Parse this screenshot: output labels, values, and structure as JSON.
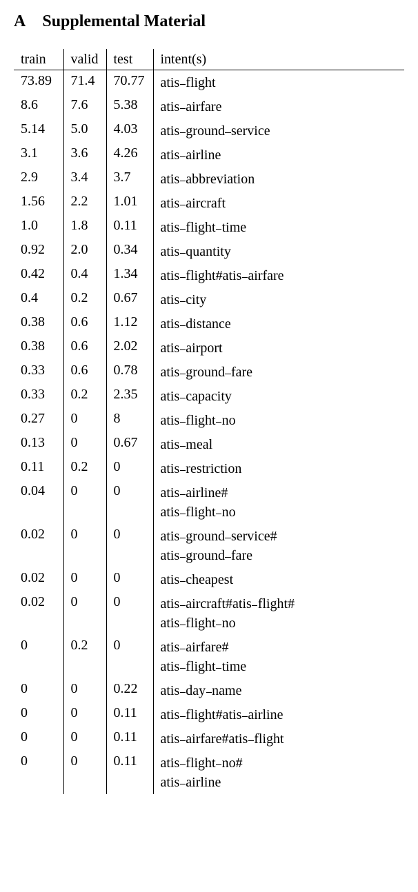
{
  "heading": {
    "section": "A",
    "title": "Supplemental Material"
  },
  "table": {
    "headers": {
      "train": "train",
      "valid": "valid",
      "test": "test",
      "intent": "intent(s)"
    },
    "rows": [
      {
        "train": "73.89",
        "valid": "71.4",
        "test": "70.77",
        "intent": [
          "atis_flight"
        ]
      },
      {
        "train": "8.6",
        "valid": "7.6",
        "test": "5.38",
        "intent": [
          "atis_airfare"
        ]
      },
      {
        "train": "5.14",
        "valid": "5.0",
        "test": "4.03",
        "intent": [
          "atis_ground_service"
        ]
      },
      {
        "train": "3.1",
        "valid": "3.6",
        "test": "4.26",
        "intent": [
          "atis_airline"
        ]
      },
      {
        "train": "2.9",
        "valid": "3.4",
        "test": "3.7",
        "intent": [
          "atis_abbreviation"
        ]
      },
      {
        "train": "1.56",
        "valid": "2.2",
        "test": "1.01",
        "intent": [
          "atis_aircraft"
        ]
      },
      {
        "train": "1.0",
        "valid": "1.8",
        "test": "0.11",
        "intent": [
          "atis_flight_time"
        ]
      },
      {
        "train": "0.92",
        "valid": "2.0",
        "test": "0.34",
        "intent": [
          "atis_quantity"
        ]
      },
      {
        "train": "0.42",
        "valid": "0.4",
        "test": "1.34",
        "intent": [
          "atis_flight#atis_airfare"
        ]
      },
      {
        "train": "0.4",
        "valid": "0.2",
        "test": "0.67",
        "intent": [
          "atis_city"
        ]
      },
      {
        "train": "0.38",
        "valid": "0.6",
        "test": "1.12",
        "intent": [
          "atis_distance"
        ]
      },
      {
        "train": "0.38",
        "valid": "0.6",
        "test": "2.02",
        "intent": [
          "atis_airport"
        ]
      },
      {
        "train": "0.33",
        "valid": "0.6",
        "test": "0.78",
        "intent": [
          "atis_ground_fare"
        ]
      },
      {
        "train": "0.33",
        "valid": "0.2",
        "test": "2.35",
        "intent": [
          "atis_capacity"
        ]
      },
      {
        "train": "0.27",
        "valid": "0",
        "test": "8",
        "intent": [
          "atis_flight_no"
        ]
      },
      {
        "train": "0.13",
        "valid": "0",
        "test": "0.67",
        "intent": [
          "atis_meal"
        ]
      },
      {
        "train": "0.11",
        "valid": "0.2",
        "test": "0",
        "intent": [
          "atis_restriction"
        ]
      },
      {
        "train": "0.04",
        "valid": "0",
        "test": "0",
        "intent": [
          "atis_airline#",
          "atis_flight_no"
        ]
      },
      {
        "train": "0.02",
        "valid": "0",
        "test": "0",
        "intent": [
          "atis_ground_service#",
          "atis_ground_fare"
        ]
      },
      {
        "train": "0.02",
        "valid": "0",
        "test": "0",
        "intent": [
          "atis_cheapest"
        ]
      },
      {
        "train": "0.02",
        "valid": "0",
        "test": "0",
        "intent": [
          "atis_aircraft#atis_flight#",
          "atis_flight_no"
        ]
      },
      {
        "train": "0",
        "valid": "0.2",
        "test": "0",
        "intent": [
          "atis_airfare#",
          "atis_flight_time"
        ]
      },
      {
        "train": "0",
        "valid": "0",
        "test": "0.22",
        "intent": [
          "atis_day_name"
        ]
      },
      {
        "train": "0",
        "valid": "0",
        "test": "0.11",
        "intent": [
          "atis_flight#atis_airline"
        ]
      },
      {
        "train": "0",
        "valid": "0",
        "test": "0.11",
        "intent": [
          "atis_airfare#atis_flight"
        ]
      },
      {
        "train": "0",
        "valid": "0",
        "test": "0.11",
        "intent": [
          "atis_flight_no#",
          "atis_airline"
        ]
      }
    ]
  }
}
